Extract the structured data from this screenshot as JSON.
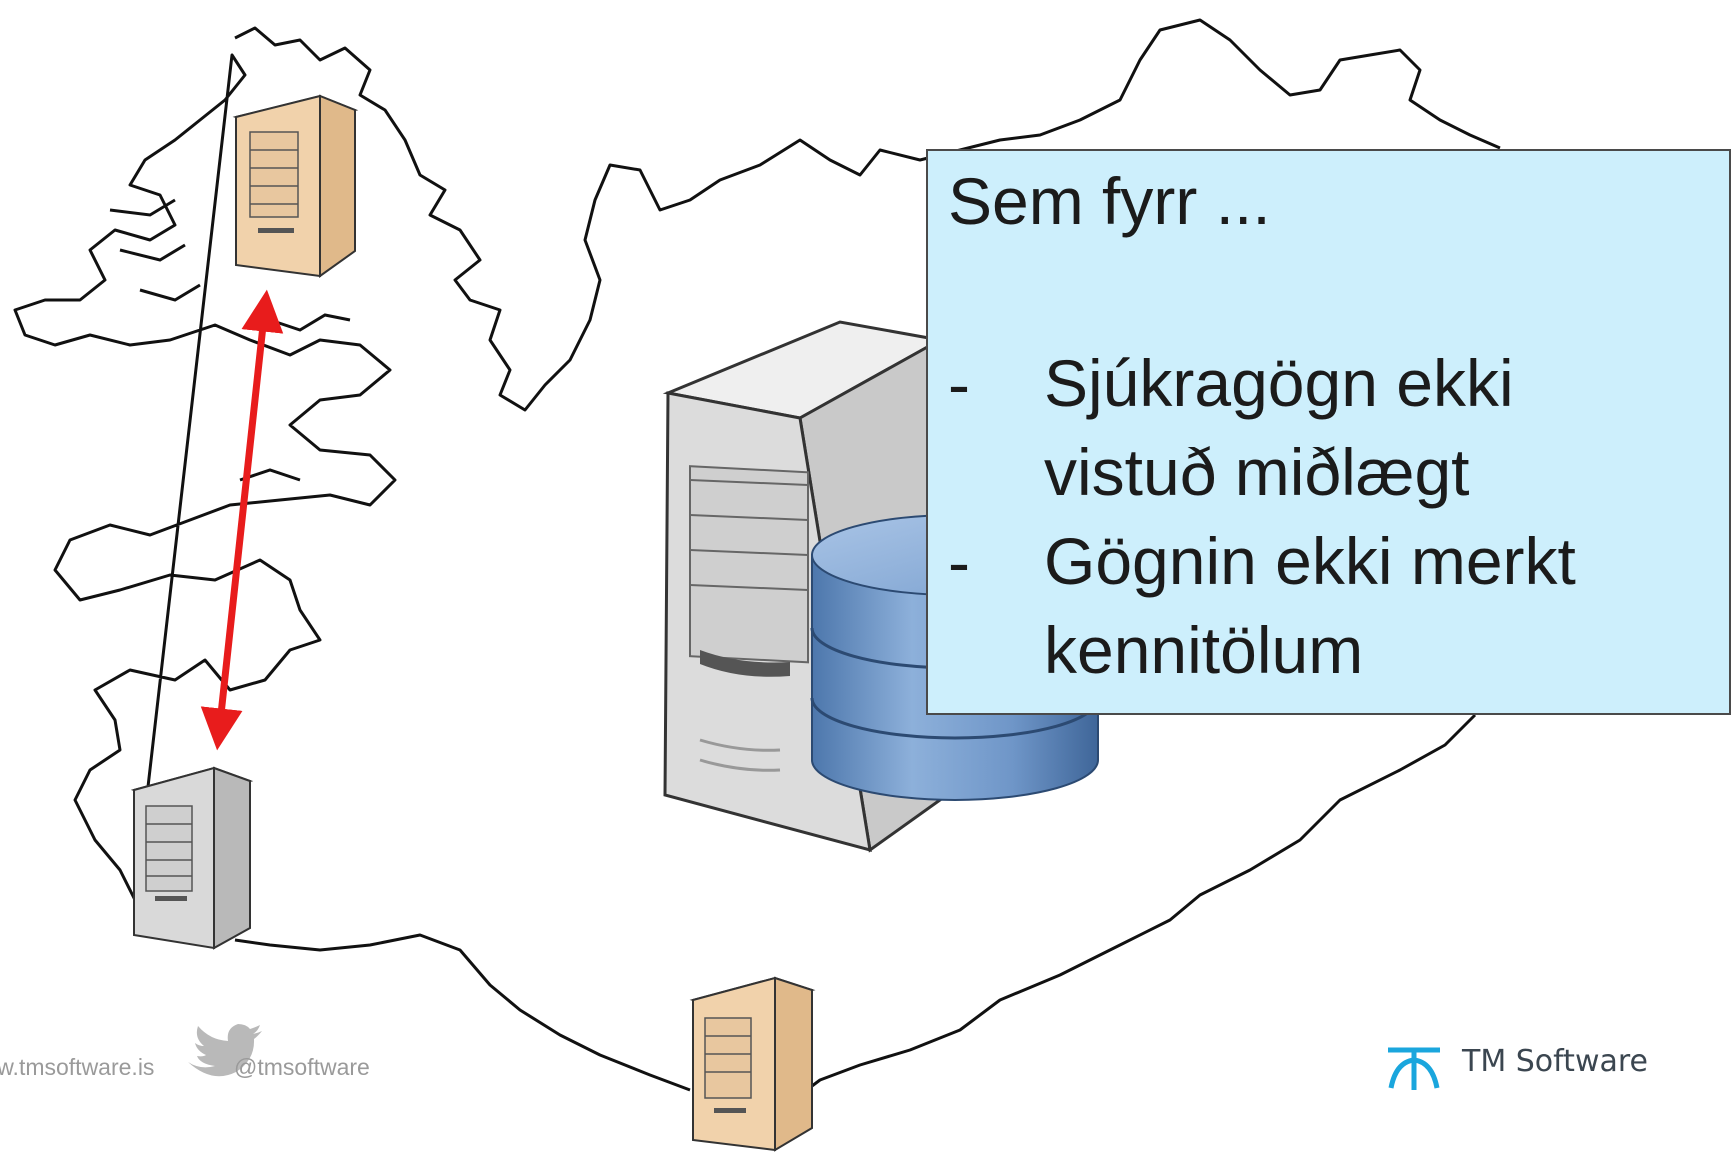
{
  "callout": {
    "title": "Sem fyrr ...",
    "bullets": [
      {
        "dash": "-",
        "line1": "Sjúkragögn ekki",
        "line2": "vistuð miðlægt"
      },
      {
        "dash": "-",
        "line1": "Gögnin ekki merkt",
        "line2": "kennitölum"
      }
    ]
  },
  "footer": {
    "website": "www.tmsoftware.is",
    "twitter_handle": "@tmsoftware",
    "brand": "TM Software"
  },
  "colors": {
    "callout_bg": "#cdeffc",
    "arrow": "#e81c1c",
    "server_beige": "#f1d2ab",
    "server_gray": "#d9d9d9",
    "database_blue": "#5e89bd",
    "twitter_bird": "#b9b9b9",
    "logo_blue": "#1aa6dd"
  }
}
